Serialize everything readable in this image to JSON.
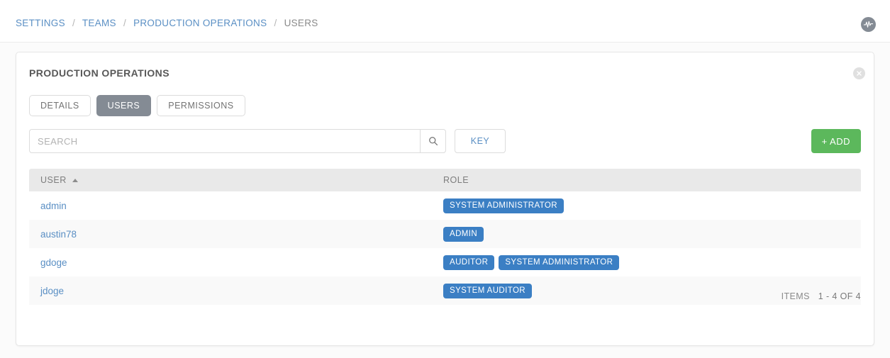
{
  "breadcrumb": {
    "items": [
      {
        "label": "Settings",
        "current": false
      },
      {
        "label": "Teams",
        "current": false
      },
      {
        "label": "Production Operations",
        "current": false
      },
      {
        "label": "Users",
        "current": true
      }
    ],
    "separator": "/"
  },
  "topbar": {
    "avatar_icon": "activity-pulse-icon"
  },
  "card": {
    "title": "Production Operations",
    "close_icon": "close-icon",
    "tabs": [
      {
        "label": "Details",
        "active": false
      },
      {
        "label": "Users",
        "active": true
      },
      {
        "label": "Permissions",
        "active": false
      }
    ],
    "search": {
      "placeholder": "SEARCH",
      "value": "",
      "search_icon": "search-icon",
      "key_label": "Key"
    },
    "add_label": "+ Add",
    "table": {
      "columns": [
        {
          "key": "user",
          "label": "User",
          "sorted": "asc"
        },
        {
          "key": "role",
          "label": "Role",
          "sorted": "none"
        }
      ],
      "rows": [
        {
          "user": "admin",
          "roles": [
            "System Administrator"
          ]
        },
        {
          "user": "austin78",
          "roles": [
            "Admin"
          ]
        },
        {
          "user": "gdoge",
          "roles": [
            "Auditor",
            "System Administrator"
          ]
        },
        {
          "user": "jdoge",
          "roles": [
            "System Auditor"
          ]
        }
      ],
      "footer": {
        "label": "Items",
        "count": "1 - 4 of 4"
      }
    }
  },
  "colors": {
    "link": "#5a8fc4",
    "badge": "#3b7fc4",
    "add_button": "#5cb85c",
    "active_tab": "#848b94",
    "table_header": "#e9e9e9"
  }
}
